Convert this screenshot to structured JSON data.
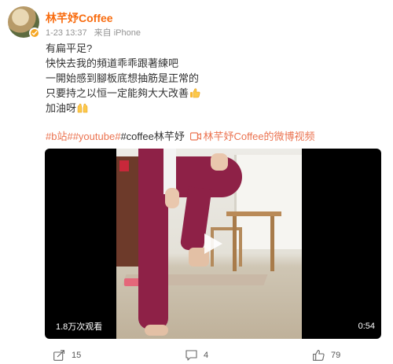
{
  "post": {
    "author": "林芊妤Coffee",
    "time": "1-23 13:37",
    "source": "来自 iPhone",
    "lines": [
      "有扁平足?",
      "快快去我的頻道乖乖跟著練吧",
      "一開始感到腳板底想抽筋是正常的",
      "只要持之以恒一定能夠大大改善",
      "加油呀"
    ],
    "emojis": [
      "thumbs-up-emoji",
      "raised-hands-emoji"
    ],
    "tags": {
      "tag1": "#b站#",
      "tag2": "#youtube#",
      "plain": "#coffee林芊妤",
      "video_link": "林芊妤Coffee的微博视频"
    }
  },
  "video": {
    "views": "1.8万次观看",
    "duration": "0:54"
  },
  "actions": {
    "share_count": "15",
    "comment_count": "4",
    "like_count": "79"
  },
  "colors": {
    "name": "#f86b0e",
    "link": "#eb7350",
    "verify_badge": "#f5a623"
  },
  "icons": [
    "verify-badge-icon",
    "video-link-icon",
    "play-icon",
    "share-icon",
    "comment-icon",
    "like-icon"
  ]
}
